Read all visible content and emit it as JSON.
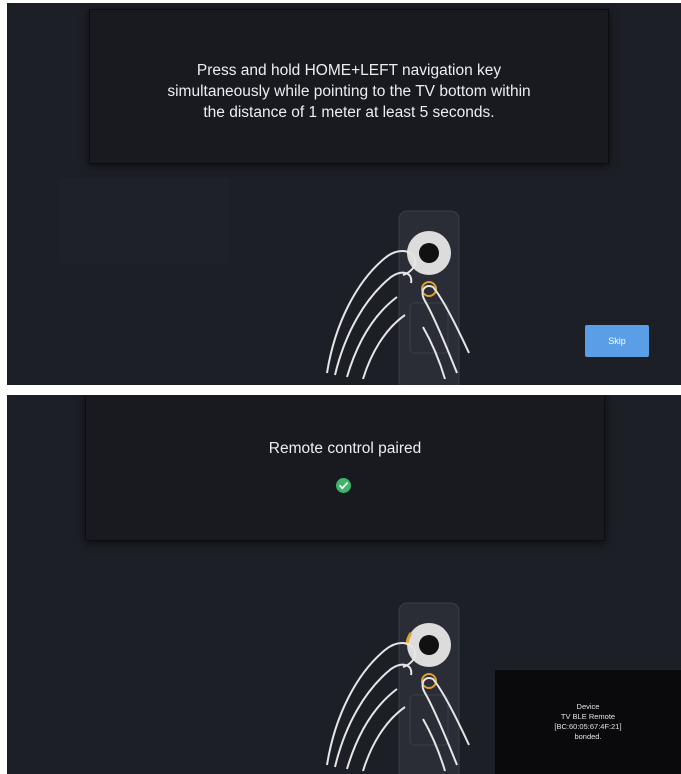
{
  "screen1": {
    "instruction_lines": [
      "Press and hold HOME+LEFT navigation key",
      "simultaneously while pointing to the TV bottom within",
      "the distance of 1 meter at least 5 seconds."
    ],
    "skip_label": "Skip",
    "colors": {
      "background": "#1c1f26",
      "skip_button": "#5b9ee8",
      "highlight_ring": "#e0a12c"
    }
  },
  "screen2": {
    "title": "Remote control paired",
    "status_icon": "check-circle-icon",
    "toast_lines": [
      "Device",
      "TV BLE Remote",
      "[BC:60:05:67:4F:21]",
      "bonded."
    ],
    "colors": {
      "check": "#3fb36b",
      "toast_background": "#0a0a0c"
    }
  }
}
